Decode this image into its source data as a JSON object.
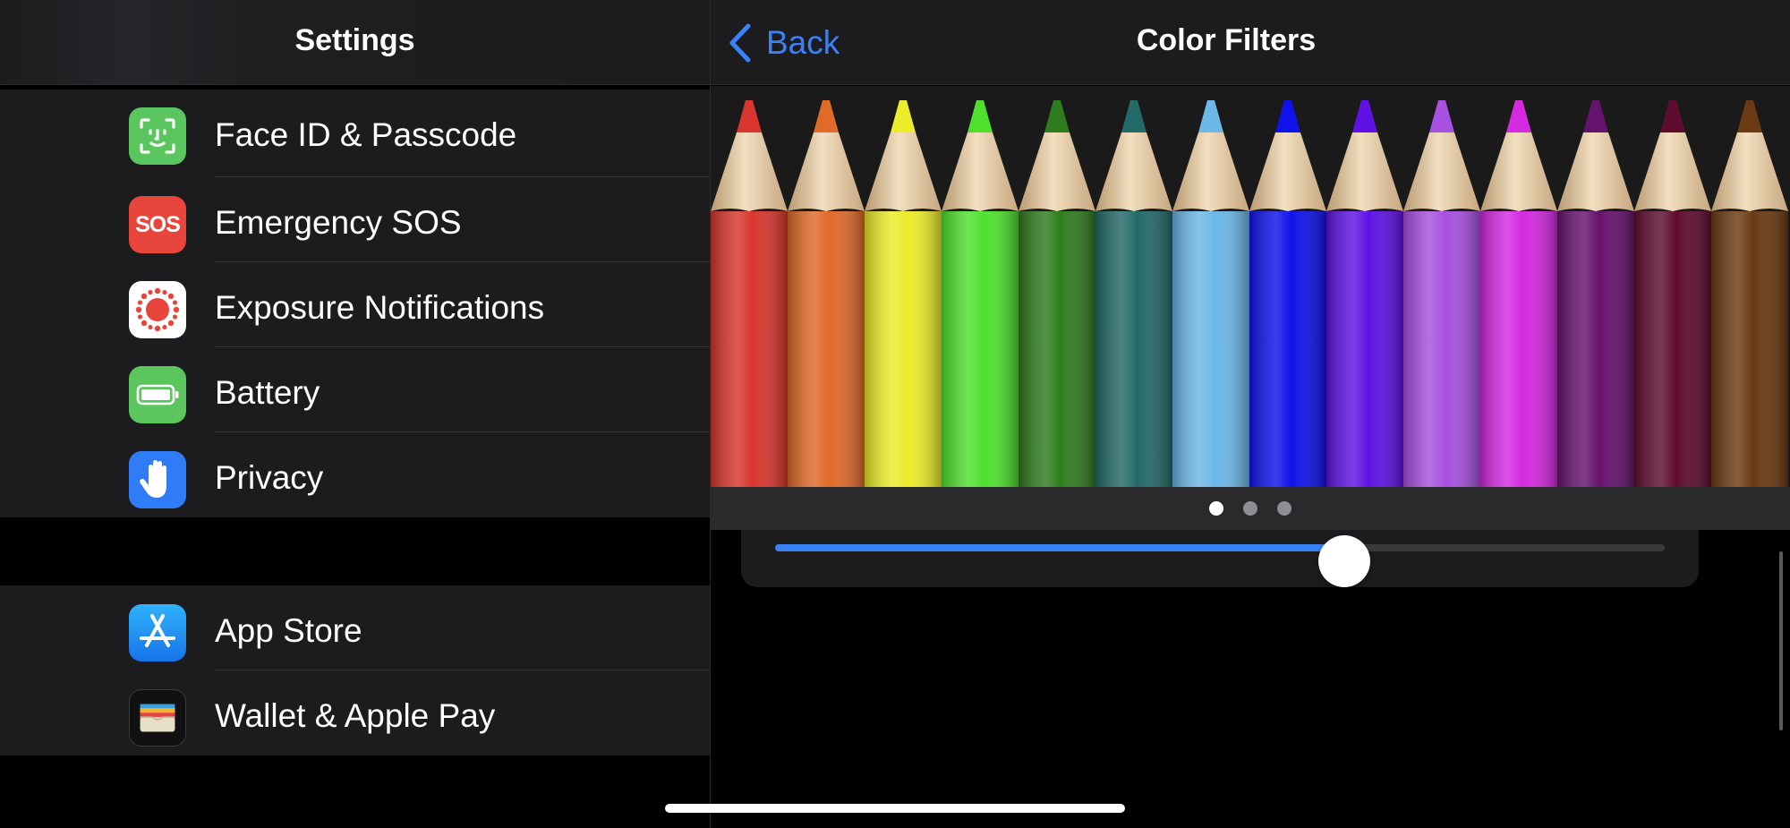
{
  "sidebar": {
    "title": "Settings",
    "group1": [
      {
        "label": "Face ID & Passcode",
        "icon": "face-id-icon",
        "color": "#34c759"
      },
      {
        "label": "Emergency SOS",
        "icon": "sos-icon",
        "color": "#e8453c",
        "icon_text": "SOS"
      },
      {
        "label": "Exposure Notifications",
        "icon": "exposure-notifications-icon",
        "color": "#ffffff"
      },
      {
        "label": "Battery",
        "icon": "battery-icon",
        "color": "#34c759"
      },
      {
        "label": "Privacy",
        "icon": "hand-icon",
        "color": "#2f7cf6"
      }
    ],
    "group2": [
      {
        "label": "App Store",
        "icon": "app-store-icon",
        "color": "#1e8ff3"
      },
      {
        "label": "Wallet & Apple Pay",
        "icon": "wallet-icon",
        "color": "#1c1c1e"
      }
    ]
  },
  "detail": {
    "back_label": "Back",
    "title": "Color Filters",
    "pencil_colors": [
      "#d8362e",
      "#e06a2a",
      "#ecec2a",
      "#4fe02e",
      "#2f7c1e",
      "#236a68",
      "#6cb8e8",
      "#0f12ea",
      "#6012e4",
      "#a850e0",
      "#d42ae2",
      "#66126e",
      "#5e0c2e",
      "#6a3a12"
    ],
    "pager": {
      "count": 3,
      "active": 0
    },
    "intensity": 0.64,
    "accent": "#3a82f7"
  }
}
